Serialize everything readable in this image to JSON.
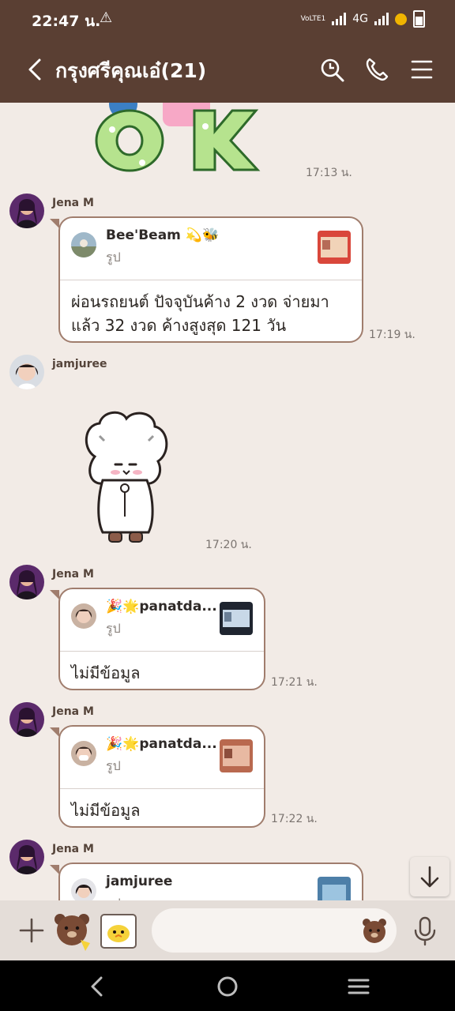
{
  "status_bar": {
    "time": "22:47 น.",
    "network": "4G",
    "volte": "VoLTE1"
  },
  "header": {
    "title": "กรุงศรีคุณเอ๋(21)"
  },
  "messages": [
    {
      "time": "17:13 น."
    },
    {
      "sender": "Jena M",
      "quote_name": "Bee'Beam 💫🐝",
      "quote_sub": "รูป",
      "text_line1": "ผ่อนรถยนต์ ปัจจุบันค้าง 2 งวด จ่ายมา",
      "text_line2": "แล้ว 32 งวด ค้างสูงสุด 121 วัน",
      "time": "17:19 น."
    },
    {
      "sender": "jamjuree",
      "time": "17:20 น."
    },
    {
      "sender": "Jena M",
      "quote_name": "🎉🌟panatda...",
      "quote_sub": "รูป",
      "text": "ไม่มีข้อมูล",
      "time": "17:21 น."
    },
    {
      "sender": "Jena M",
      "quote_name": "🎉🌟panatda...",
      "quote_sub": "รูป",
      "text": "ไม่มีข้อมูล",
      "time": "17:22 น."
    },
    {
      "sender": "Jena M",
      "quote_name": "jamjuree",
      "quote_sub": "รูป"
    }
  ],
  "colors": {
    "header_bg": "#5a3f33",
    "chat_bg": "#f2ebe6",
    "bubble_border": "#a07d6d"
  },
  "icons": [
    "back-icon",
    "search-icon",
    "call-icon",
    "menu-icon",
    "plus-icon",
    "sticker-icon",
    "image-icon",
    "emoji-icon",
    "mic-icon",
    "scroll-down-icon"
  ]
}
